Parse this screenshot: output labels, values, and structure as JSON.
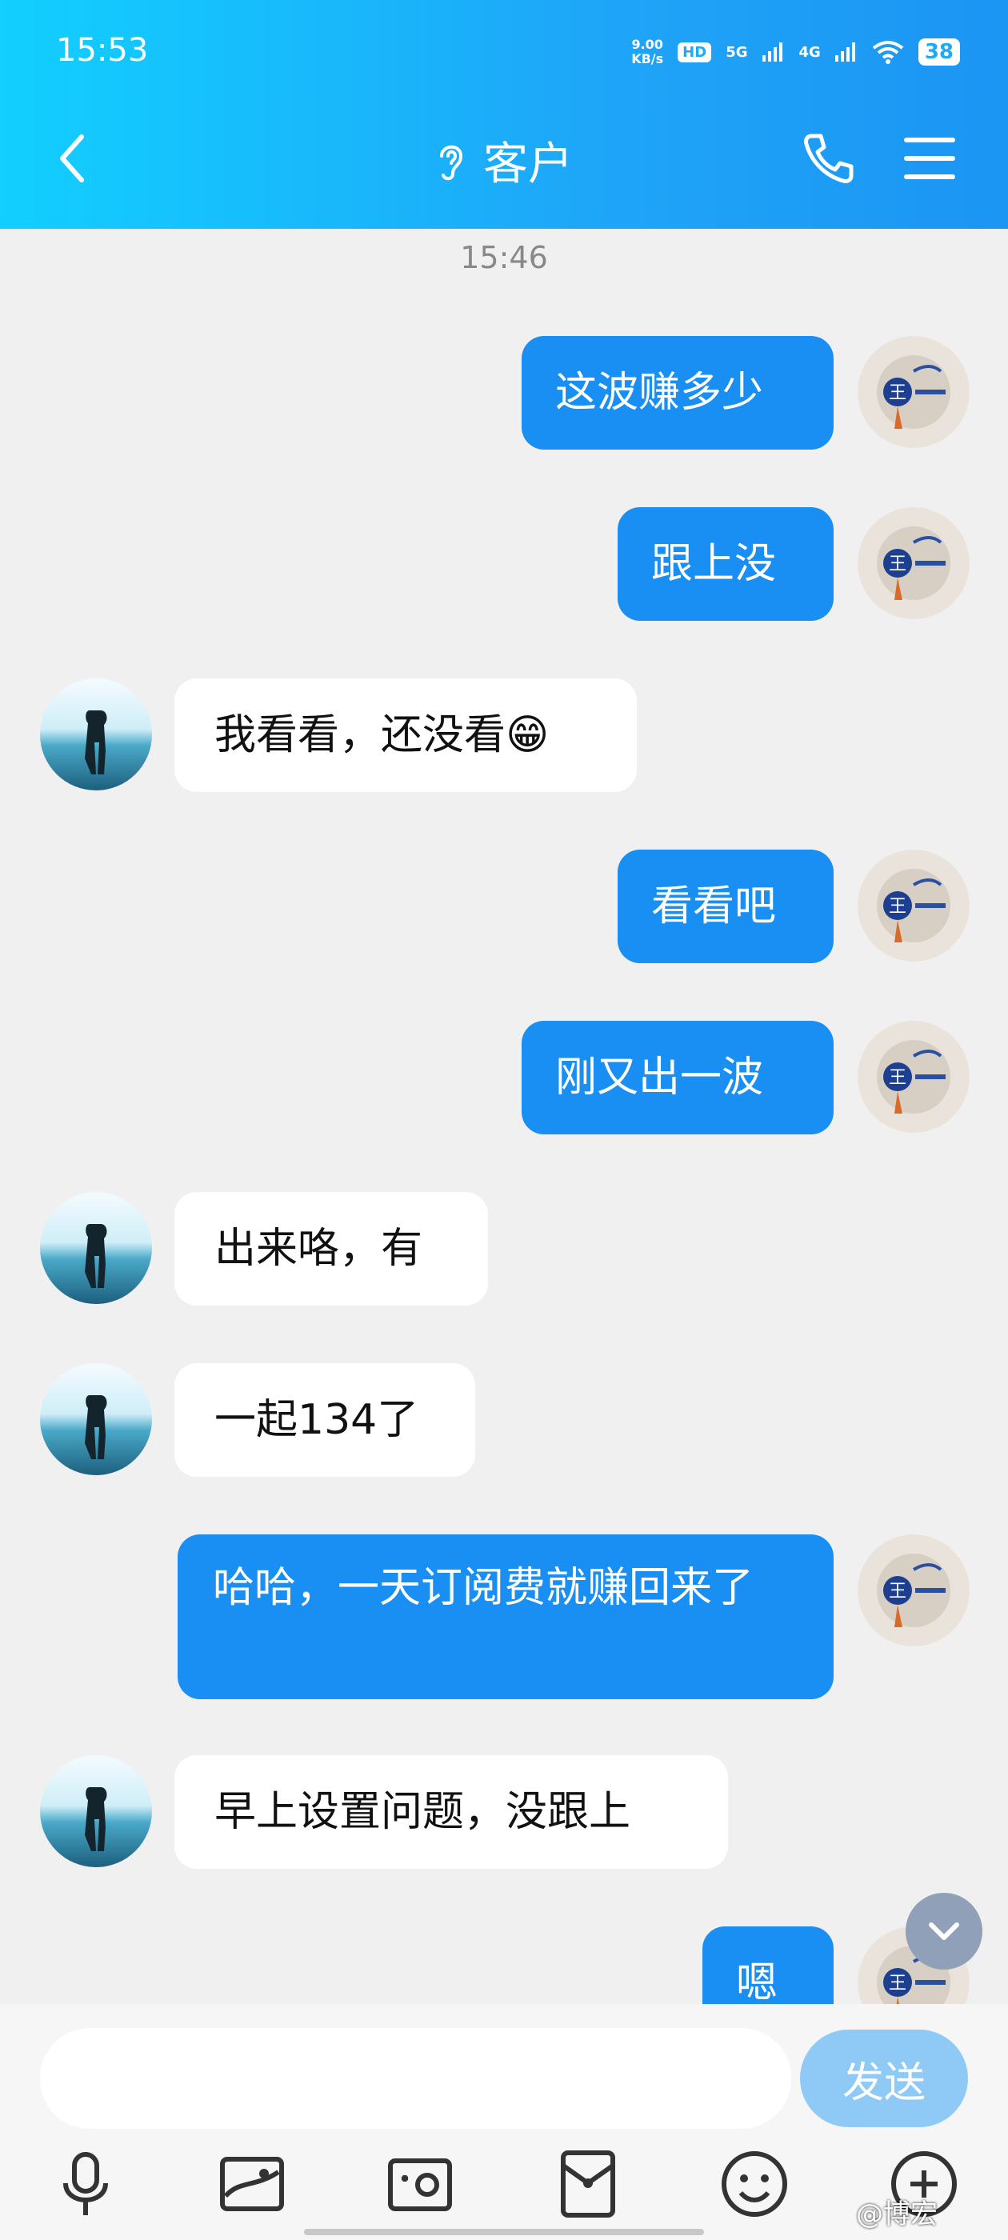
{
  "status_bar": {
    "time": "15:53",
    "net_speed": "9.00\nKB/s",
    "hd_badge": "HD",
    "sim_label_1": "5G",
    "sim_label_2": "4G",
    "battery": "38"
  },
  "header": {
    "title": "客户",
    "back_icon": "chevron-left-icon",
    "ear_icon": "ear-icon",
    "call_icon": "phone-icon",
    "menu_icon": "menu-icon"
  },
  "chat": {
    "timestamp": "15:46",
    "messages": [
      {
        "side": "out",
        "text": "这波赚多少"
      },
      {
        "side": "out",
        "text": "跟上没"
      },
      {
        "side": "in",
        "text": "我看看，还没看😁"
      },
      {
        "side": "out",
        "text": "看看吧"
      },
      {
        "side": "out",
        "text": "刚又出一波"
      },
      {
        "side": "in",
        "text": "出来咯，有"
      },
      {
        "side": "in",
        "text": "一起134了"
      },
      {
        "side": "out",
        "text": "哈哈，一天订阅费就赚回来了"
      },
      {
        "side": "in",
        "text": "早上设置问题，没跟上"
      },
      {
        "side": "out",
        "text": "嗯"
      }
    ]
  },
  "composer": {
    "input_value": "",
    "send_label": "发送",
    "toolbar_icons": [
      "microphone-icon",
      "image-icon",
      "camera-icon",
      "red-packet-icon",
      "emoji-icon",
      "more-icon"
    ]
  },
  "watermark": "@博宏",
  "colors": {
    "header_start": "#12cfff",
    "header_end": "#1c95f3",
    "outgoing_bubble": "#1a8ff3",
    "incoming_bubble": "#ffffff",
    "background": "#f0f0f0",
    "send_button": "#8fcaf7"
  }
}
